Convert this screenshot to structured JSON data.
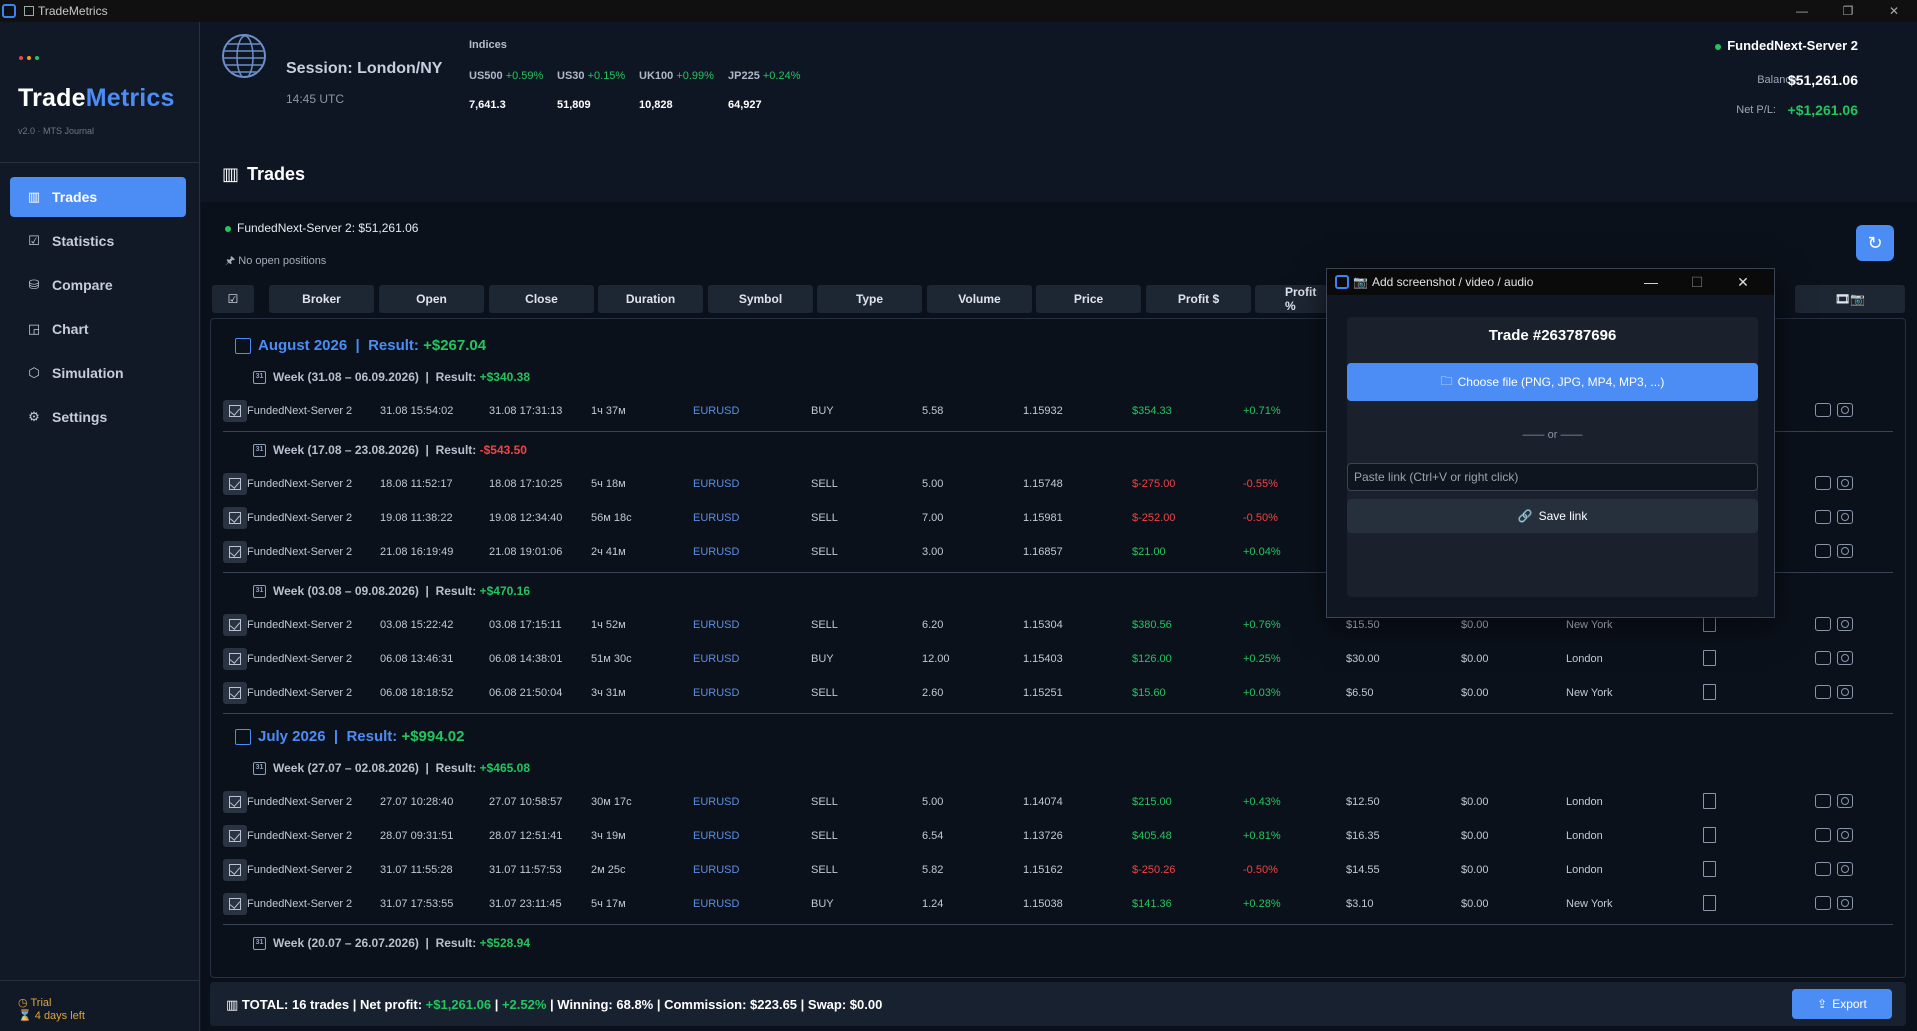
{
  "window": {
    "title": "TradeMetrics"
  },
  "sidebar": {
    "logo_main": "Trade",
    "logo_accent": "Metrics",
    "version": "v2.0 · MTS Journal",
    "items": [
      {
        "label": "Trades",
        "icon": "trades-icon"
      },
      {
        "label": "Statistics",
        "icon": "statistics-icon"
      },
      {
        "label": "Compare",
        "icon": "compare-icon"
      },
      {
        "label": "Chart",
        "icon": "chart-icon"
      },
      {
        "label": "Simulation",
        "icon": "simulation-icon"
      },
      {
        "label": "Settings",
        "icon": "settings-icon"
      }
    ],
    "trial_line1": "Trial",
    "trial_line2": "4 days left"
  },
  "header": {
    "session": "Session: London/NY",
    "time": "14:45 UTC",
    "indices_title": "Indices",
    "indices": [
      {
        "name": "US500",
        "change": "+0.59%",
        "value": "7,641.3"
      },
      {
        "name": "US30",
        "change": "+0.15%",
        "value": "51,809"
      },
      {
        "name": "UK100",
        "change": "+0.99%",
        "value": "10,828"
      },
      {
        "name": "JP225",
        "change": "+0.24%",
        "value": "64,927"
      }
    ],
    "server": "FundedNext-Server 2",
    "balance_label": "Balance:",
    "balance_value": "$51,261.06",
    "netpl_label": "Net P/L:",
    "netpl_value": "+$1,261.06"
  },
  "page": {
    "title": "Trades",
    "account_line": "FundedNext-Server 2: $51,261.06",
    "no_positions": "No open positions"
  },
  "columns": [
    "☑",
    "Broker",
    "Open",
    "Close",
    "Duration",
    "Symbol",
    "Type",
    "Volume",
    "Price",
    "Profit $",
    "Profit %",
    "🎞📷"
  ],
  "groups": {
    "aug_title": "August 2026",
    "aug_result_label": "Result:",
    "aug_result": "+$267.04",
    "jul_title": "July 2026",
    "jul_result_label": "Result:",
    "jul_result": "+$994.02",
    "w1_label": "Week (31.08 – 06.09.2026)",
    "w1_result": "+$340.38",
    "w2_label": "Week (17.08 – 23.08.2026)",
    "w2_result": "-$543.50",
    "w3_label": "Week (03.08 – 09.08.2026)",
    "w3_result": "+$470.16",
    "w4_label": "Week (27.07 – 02.08.2026)",
    "w4_result": "+$465.08",
    "w5_label": "Week (20.07 – 26.07.2026)",
    "w5_result": "+$528.94",
    "result_label": "Result:"
  },
  "rows": [
    {
      "broker": "FundedNext-Server 2",
      "open": "31.08 15:54:02",
      "close": "31.08 17:31:13",
      "duration": "1ч 37м",
      "symbol": "EURUSD",
      "type": "BUY",
      "volume": "5.58",
      "price": "1.15932",
      "profit": "$354.33",
      "pct": "+0.71%",
      "comm": "",
      "swap": "",
      "session": ""
    },
    {
      "broker": "FundedNext-Server 2",
      "open": "18.08 11:52:17",
      "close": "18.08 17:10:25",
      "duration": "5ч 18м",
      "symbol": "EURUSD",
      "type": "SELL",
      "volume": "5.00",
      "price": "1.15748",
      "profit": "$-275.00",
      "pct": "-0.55%",
      "comm": "",
      "swap": "",
      "session": ""
    },
    {
      "broker": "FundedNext-Server 2",
      "open": "19.08 11:38:22",
      "close": "19.08 12:34:40",
      "duration": "56м 18с",
      "symbol": "EURUSD",
      "type": "SELL",
      "volume": "7.00",
      "price": "1.15981",
      "profit": "$-252.00",
      "pct": "-0.50%",
      "comm": "",
      "swap": "",
      "session": ""
    },
    {
      "broker": "FundedNext-Server 2",
      "open": "21.08 16:19:49",
      "close": "21.08 19:01:06",
      "duration": "2ч 41м",
      "symbol": "EURUSD",
      "type": "SELL",
      "volume": "3.00",
      "price": "1.16857",
      "profit": "$21.00",
      "pct": "+0.04%",
      "comm": "",
      "swap": "",
      "session": ""
    },
    {
      "broker": "FundedNext-Server 2",
      "open": "03.08 15:22:42",
      "close": "03.08 17:15:11",
      "duration": "1ч 52м",
      "symbol": "EURUSD",
      "type": "SELL",
      "volume": "6.20",
      "price": "1.15304",
      "profit": "$380.56",
      "pct": "+0.76%",
      "comm": "$15.50",
      "swap": "$0.00",
      "session": "New York"
    },
    {
      "broker": "FundedNext-Server 2",
      "open": "06.08 13:46:31",
      "close": "06.08 14:38:01",
      "duration": "51м 30с",
      "symbol": "EURUSD",
      "type": "BUY",
      "volume": "12.00",
      "price": "1.15403",
      "profit": "$126.00",
      "pct": "+0.25%",
      "comm": "$30.00",
      "swap": "$0.00",
      "session": "London"
    },
    {
      "broker": "FundedNext-Server 2",
      "open": "06.08 18:18:52",
      "close": "06.08 21:50:04",
      "duration": "3ч 31м",
      "symbol": "EURUSD",
      "type": "SELL",
      "volume": "2.60",
      "price": "1.15251",
      "profit": "$15.60",
      "pct": "+0.03%",
      "comm": "$6.50",
      "swap": "$0.00",
      "session": "New York"
    },
    {
      "broker": "FundedNext-Server 2",
      "open": "27.07 10:28:40",
      "close": "27.07 10:58:57",
      "duration": "30м 17с",
      "symbol": "EURUSD",
      "type": "SELL",
      "volume": "5.00",
      "price": "1.14074",
      "profit": "$215.00",
      "pct": "+0.43%",
      "comm": "$12.50",
      "swap": "$0.00",
      "session": "London"
    },
    {
      "broker": "FundedNext-Server 2",
      "open": "28.07 09:31:51",
      "close": "28.07 12:51:41",
      "duration": "3ч 19м",
      "symbol": "EURUSD",
      "type": "SELL",
      "volume": "6.54",
      "price": "1.13726",
      "profit": "$405.48",
      "pct": "+0.81%",
      "comm": "$16.35",
      "swap": "$0.00",
      "session": "London"
    },
    {
      "broker": "FundedNext-Server 2",
      "open": "31.07 11:55:28",
      "close": "31.07 11:57:53",
      "duration": "2м 25с",
      "symbol": "EURUSD",
      "type": "SELL",
      "volume": "5.82",
      "price": "1.15162",
      "profit": "$-250.26",
      "pct": "-0.50%",
      "comm": "$14.55",
      "swap": "$0.00",
      "session": "London"
    },
    {
      "broker": "FundedNext-Server 2",
      "open": "31.07 17:53:55",
      "close": "31.07 23:11:45",
      "duration": "5ч 17м",
      "symbol": "EURUSD",
      "type": "BUY",
      "volume": "1.24",
      "price": "1.15038",
      "profit": "$141.36",
      "pct": "+0.28%",
      "comm": "$3.10",
      "swap": "$0.00",
      "session": "New York"
    }
  ],
  "footer": {
    "prefix": "TOTAL: 16 trades | Net profit: ",
    "net": "+$1,261.06",
    "mid1": " | ",
    "pct": "+2.52%",
    "rest": " | Winning: 68.8% | Commission: $223.65 | Swap: $0.00",
    "export_label": "Export"
  },
  "dialog": {
    "title": "Add screenshot / video / audio",
    "trade": "Trade #263787696",
    "choose_label": "Choose file (PNG, JPG, MP4, MP3, ...)",
    "or_text": "—— or ——",
    "link_placeholder": "Paste link (Ctrl+V or right click)",
    "save_label": "Save link"
  },
  "colors": {
    "accent": "#4b8cf5",
    "positive": "#22c55e",
    "negative": "#ef4444"
  }
}
